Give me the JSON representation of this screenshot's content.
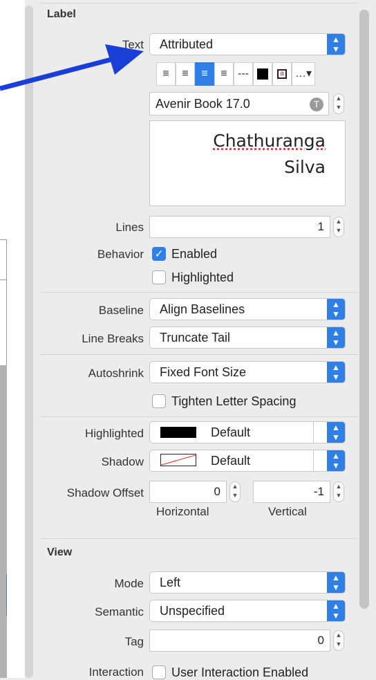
{
  "label_section": {
    "title": "Label",
    "text_label": "Text",
    "text_value": "Attributed",
    "font_value": "Avenir Book 17.0",
    "preview_line1": "Chathuranga",
    "preview_line2": "Silva",
    "lines_label": "Lines",
    "lines_value": "1",
    "behavior_label": "Behavior",
    "enabled_label": "Enabled",
    "highlighted_check_label": "Highlighted",
    "baseline_label": "Baseline",
    "baseline_value": "Align Baselines",
    "linebreaks_label": "Line Breaks",
    "linebreaks_value": "Truncate Tail",
    "autoshrink_label": "Autoshrink",
    "autoshrink_value": "Fixed Font Size",
    "tighten_label": "Tighten Letter Spacing",
    "highlighted_label": "Highlighted",
    "highlighted_value": "Default",
    "shadow_label": "Shadow",
    "shadow_value": "Default",
    "shadow_offset_label": "Shadow Offset",
    "horizontal_value": "0",
    "vertical_value": "-1",
    "horizontal_label": "Horizontal",
    "vertical_label": "Vertical",
    "enabled_checked": true,
    "highlighted_checked": false,
    "tighten_checked": false
  },
  "align_bar": {
    "buttons": [
      "align-left-icon",
      "align-center-icon",
      "align-right-icon",
      "align-justify-icon",
      "dashes-icon",
      "color-swatch-icon",
      "background-icon",
      "more-icon"
    ],
    "selected": "align-right-icon"
  },
  "view_section": {
    "title": "View",
    "mode_label": "Mode",
    "mode_value": "Left",
    "semantic_label": "Semantic",
    "semantic_value": "Unspecified",
    "tag_label": "Tag",
    "tag_value": "0",
    "interaction_label": "Interaction",
    "user_interaction_label": "User Interaction Enabled"
  },
  "colors": {
    "accent": "#2f7fe6",
    "arrow": "#1a3fd8",
    "panel_bg": "#ececec"
  }
}
